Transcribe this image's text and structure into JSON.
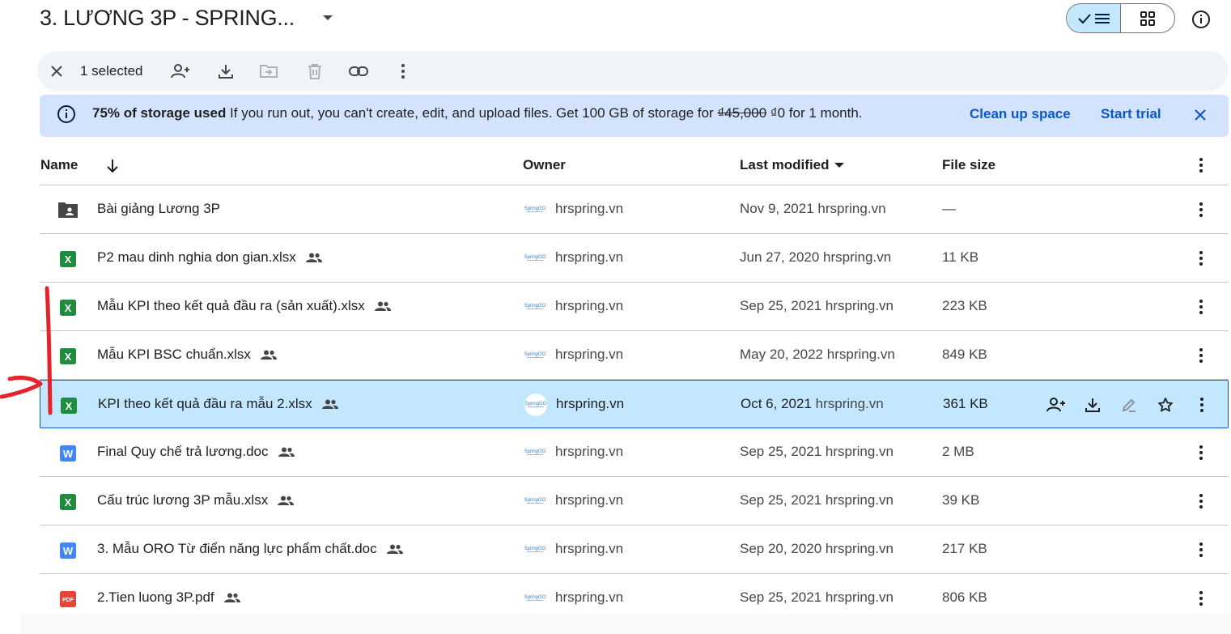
{
  "header": {
    "title": "3. LƯƠNG 3P - SPRING..."
  },
  "selection_bar": {
    "count_label": "1 selected"
  },
  "banner": {
    "bold": "75% of storage used",
    "text_before": " If you run out, you can't create, edit, and upload files. Get 100 GB of storage for ",
    "old_price": "₫45,000",
    "text_middle": " ",
    "new_price": "₫0",
    "text_after": " for 1 month.",
    "cleanup_label": "Clean up space",
    "trial_label": "Start trial"
  },
  "table": {
    "headers": {
      "name": "Name",
      "owner": "Owner",
      "last_modified": "Last modified",
      "file_size": "File size"
    },
    "rows": [
      {
        "name": "Bài giảng Lương 3P",
        "type": "shared-folder",
        "shared": false,
        "owner": "hrspring.vn",
        "date": "Nov 9, 2021",
        "by": "hrspring.vn",
        "size": "—",
        "selected": false
      },
      {
        "name": "P2 mau dinh nghia don gian.xlsx",
        "type": "xlsx",
        "shared": true,
        "owner": "hrspring.vn",
        "date": "Jun 27, 2020",
        "by": "hrspring.vn",
        "size": "11 KB",
        "selected": false
      },
      {
        "name": "Mẫu KPI theo kết quả đầu ra (sản xuất).xlsx",
        "type": "xlsx",
        "shared": true,
        "owner": "hrspring.vn",
        "date": "Sep 25, 2021",
        "by": "hrspring.vn",
        "size": "223 KB",
        "selected": false
      },
      {
        "name": "Mẫu KPI BSC chuẩn.xlsx",
        "type": "xlsx",
        "shared": true,
        "owner": "hrspring.vn",
        "date": "May 20, 2022",
        "by": "hrspring.vn",
        "size": "849 KB",
        "selected": false
      },
      {
        "name": "KPI theo kết quả đầu ra mẫu 2.xlsx",
        "type": "xlsx",
        "shared": true,
        "owner": "hrspring.vn",
        "date": "Oct 6, 2021",
        "by": "hrspring.vn",
        "size": "361 KB",
        "selected": true
      },
      {
        "name": "Final Quy chế trả lương.doc",
        "type": "doc",
        "shared": true,
        "owner": "hrspring.vn",
        "date": "Sep 25, 2021",
        "by": "hrspring.vn",
        "size": "2 MB",
        "selected": false
      },
      {
        "name": "Cấu trúc lương 3P mẫu.xlsx",
        "type": "xlsx",
        "shared": true,
        "owner": "hrspring.vn",
        "date": "Sep 25, 2021",
        "by": "hrspring.vn",
        "size": "39 KB",
        "selected": false
      },
      {
        "name": "3. Mẫu ORO Từ điển năng lực phẩm chất.doc",
        "type": "doc",
        "shared": true,
        "owner": "hrspring.vn",
        "date": "Sep 20, 2020",
        "by": "hrspring.vn",
        "size": "217 KB",
        "selected": false
      },
      {
        "name": "2.Tien luong 3P.pdf",
        "type": "pdf",
        "shared": true,
        "owner": "hrspring.vn",
        "date": "Sep 25, 2021",
        "by": "hrspring.vn",
        "size": "806 KB",
        "selected": false
      }
    ]
  },
  "icons": {
    "xlsx_label": "X",
    "doc_label": "W",
    "pdf_label": "PDF",
    "owner_logo": "SpringGO"
  },
  "colors": {
    "accent": "#0b57d0",
    "selected_row": "#c2e7ff",
    "banner_bg": "#d3e3fd",
    "selbar_bg": "#f0f4f9",
    "xlsx": "#1e8e3e",
    "doc": "#4285f4",
    "pdf": "#ea4335",
    "annotation": "#e3242b"
  }
}
